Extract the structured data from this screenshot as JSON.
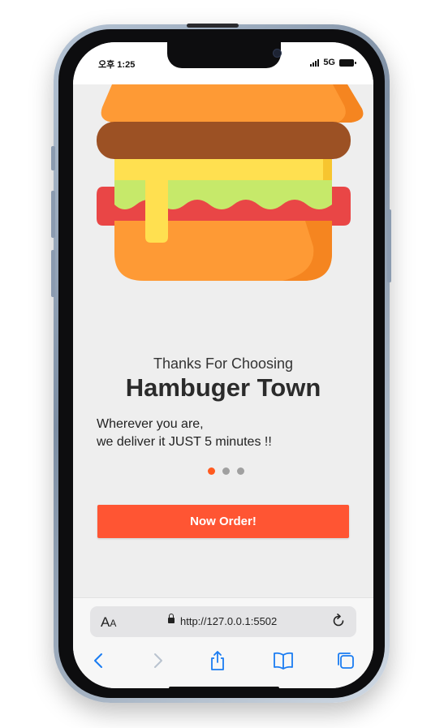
{
  "status_bar": {
    "time": "오후 1:25",
    "network": "5G"
  },
  "app": {
    "subtitle": "Thanks For Choosing",
    "title": "Hambuger Town",
    "description_line1": "Wherever you are,",
    "description_line2": "we deliver it JUST 5 minutes !!",
    "order_button": "Now Order!",
    "pagination": {
      "total": 3,
      "active_index": 0
    },
    "colors": {
      "accent": "#ff5533",
      "active_dot": "#ff5a1f",
      "inactive_dot": "#a0a0a0",
      "background": "#eeeeee"
    }
  },
  "browser": {
    "text_size_label": "AA",
    "url": "http://127.0.0.1:5502",
    "toolbar_icons": [
      "back-icon",
      "forward-icon",
      "share-icon",
      "bookmarks-icon",
      "tabs-icon"
    ]
  }
}
